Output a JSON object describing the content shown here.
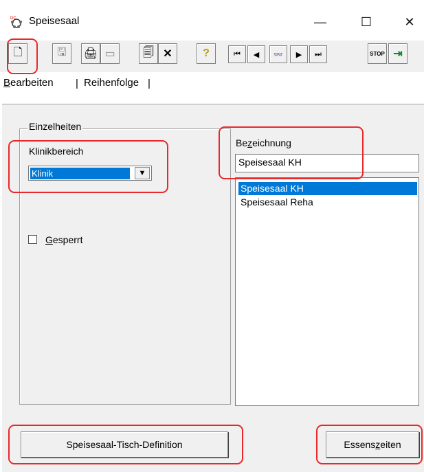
{
  "window": {
    "title": "Speisesaal",
    "minimize": "—",
    "maximize": "☐",
    "close": "✕"
  },
  "toolbar": {
    "new": "🗋",
    "save": "🖫",
    "print": "🖨",
    "preview": "▭",
    "properties": "🗐",
    "delete": "✕",
    "help": "?",
    "first": "⏮",
    "prev": "◀",
    "find": "👓",
    "next": "▶",
    "last": "⏭",
    "stop": "STOP",
    "exit": "⇥"
  },
  "tabs": [
    {
      "label": "Bearbeiten",
      "hotkey": "B"
    },
    {
      "label": "Reihenfolge",
      "hotkey": ""
    }
  ],
  "group": {
    "label": "Einzelheiten"
  },
  "klinikbereich": {
    "label": "Klinikbereich",
    "value": "Klinik"
  },
  "gesperrt": {
    "label": "Gesperrt",
    "checked": false
  },
  "bezeichnung": {
    "label": "Bezeichnung",
    "value": "Speisesaal KH"
  },
  "list": {
    "items": [
      "Speisesaal KH",
      "Speisesaal Reha"
    ],
    "selected_index": 0
  },
  "buttons": {
    "tischdef": "Speisesaal-Tisch-Definition",
    "essenszeiten": "Essenszeiten"
  },
  "colors": {
    "highlight": "#e8282b",
    "selection": "#0078d7"
  }
}
